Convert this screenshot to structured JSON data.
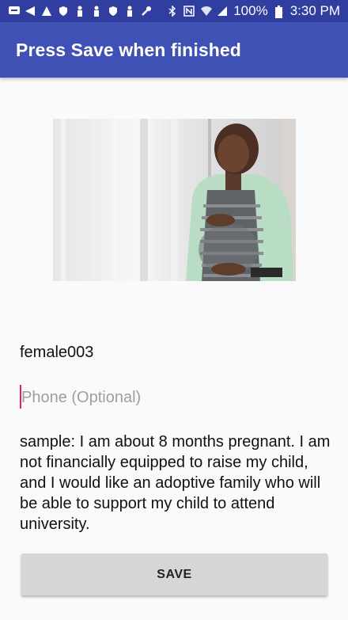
{
  "status_bar": {
    "battery": "100%",
    "time": "3:30 PM",
    "icons_left": [
      "message-icon",
      "send-icon",
      "warning-icon",
      "shield-icon",
      "person-icon",
      "person-icon",
      "shield-icon",
      "person-icon",
      "wrench-icon"
    ],
    "icons_right": [
      "bluetooth-icon",
      "nfc-icon",
      "wifi-icon",
      "signal-icon",
      "battery-icon"
    ],
    "bg_color": "#303f9f"
  },
  "toolbar": {
    "title": "Press Save when finished",
    "bg_color": "#3f51b5"
  },
  "form": {
    "username": "female003",
    "phone_placeholder": "Phone (Optional)",
    "phone_value": "",
    "description": "sample:  I am about 8 months pregnant.  I am not financially equipped to raise my child, and I would like an adoptive family who will be able to support my child to attend university.",
    "save_label": "SAVE",
    "cursor_color": "#e91e63"
  }
}
